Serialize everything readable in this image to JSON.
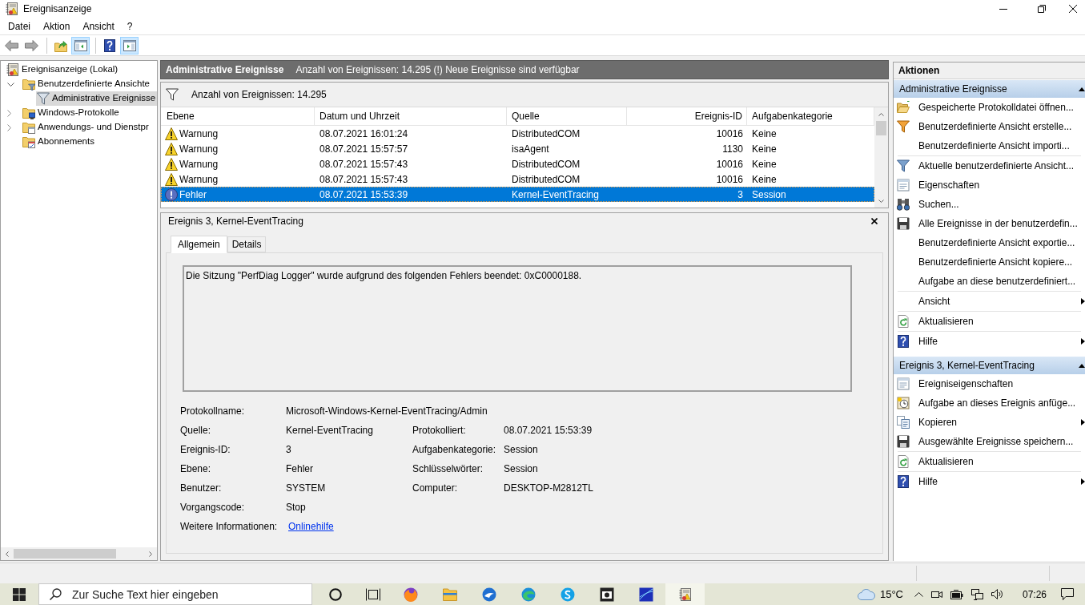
{
  "window": {
    "title": "Ereignisanzeige"
  },
  "menu": [
    "Datei",
    "Aktion",
    "Ansicht",
    "?"
  ],
  "toolbar": [
    [
      {
        "disabled": true,
        "pressed": false
      },
      {
        "disabled": true,
        "pressed": false
      }
    ],
    [
      {
        "disabled": false,
        "pressed": false
      },
      {
        "disabled": false,
        "pressed": true
      }
    ],
    [
      {
        "disabled": false,
        "pressed": false
      },
      {
        "disabled": false,
        "pressed": true
      }
    ]
  ],
  "tree": {
    "label": "Ereignisanzeige (Lokal)",
    "selected": false,
    "children": [
      {
        "label": "Benutzerdefinierte Ansichte",
        "expanded": true,
        "selected": false,
        "children": [
          {
            "label": "Administrative Ereignisse",
            "selected": true
          }
        ]
      },
      {
        "label": "Windows-Protokolle",
        "expanded": false,
        "selected": false
      },
      {
        "label": "Anwendungs- und Dienstpr",
        "expanded": false,
        "selected": false
      },
      {
        "label": "Abonnements",
        "selected": false
      }
    ]
  },
  "events_view": {
    "title": "Administrative Ereignisse",
    "notice": "Anzahl von Ereignissen: 14.295 (!) Neue Ereignisse sind verfügbar",
    "filter_summary": "Anzahl von Ereignissen: 14.295"
  },
  "table": {
    "columns": [
      "Ebene",
      "Datum und Uhrzeit",
      "Quelle",
      "Ereignis-ID",
      "Aufgabenkategorie"
    ],
    "rows": [
      {
        "kind": "warning",
        "selected": false,
        "cells": [
          "Warnung",
          "08.07.2021 16:01:24",
          "DistributedCOM",
          "10016",
          "Keine"
        ]
      },
      {
        "kind": "warning",
        "selected": false,
        "cells": [
          "Warnung",
          "08.07.2021 15:57:57",
          "isaAgent",
          "1130",
          "Keine"
        ]
      },
      {
        "kind": "warning",
        "selected": false,
        "cells": [
          "Warnung",
          "08.07.2021 15:57:43",
          "DistributedCOM",
          "10016",
          "Keine"
        ]
      },
      {
        "kind": "warning",
        "selected": false,
        "cells": [
          "Warnung",
          "08.07.2021 15:57:43",
          "DistributedCOM",
          "10016",
          "Keine"
        ]
      },
      {
        "kind": "error",
        "selected": true,
        "cells": [
          "Fehler",
          "08.07.2021 15:53:39",
          "Kernel-EventTracing",
          "3",
          "Session"
        ]
      }
    ]
  },
  "details": {
    "title": "Ereignis 3, Kernel-EventTracing",
    "tabs": [
      {
        "label": "Allgemein",
        "selected": true
      },
      {
        "label": "Details",
        "selected": false
      }
    ],
    "description": "Die Sitzung \"PerfDiag Logger\" wurde aufgrund des folgenden Fehlers beendet: 0xC0000188.",
    "property_rows": [
      [
        {
          "label": "Protokollname:",
          "value": "Microsoft-Windows-Kernel-EventTracing/Admin"
        }
      ],
      [
        {
          "label": "Quelle:",
          "value": "Kernel-EventTracing"
        },
        {
          "label": "Protokolliert:",
          "value": "08.07.2021 15:53:39"
        }
      ],
      [
        {
          "label": "Ereignis-ID:",
          "value": "3"
        },
        {
          "label": "Aufgabenkategorie:",
          "value": "Session"
        }
      ],
      [
        {
          "label": "Ebene:",
          "value": "Fehler"
        },
        {
          "label": "Schlüsselwörter:",
          "value": "Session"
        }
      ],
      [
        {
          "label": "Benutzer:",
          "value": "SYSTEM"
        },
        {
          "label": "Computer:",
          "value": "DESKTOP-M2812TL"
        }
      ],
      [
        {
          "label": "Vorgangscode:",
          "value": "Stop"
        }
      ]
    ],
    "more_info": {
      "label": "Weitere Informationen:",
      "link": "Onlinehilfe"
    }
  },
  "actions": {
    "title": "Aktionen",
    "sections": [
      {
        "title": "Administrative Ereignisse",
        "expanded": true,
        "groups": [
          [
            {
              "label": "Gespeicherte Protokolldatei öffnen...",
              "submenu": false
            },
            {
              "label": "Benutzerdefinierte Ansicht erstelle...",
              "submenu": false
            },
            {
              "label": "Benutzerdefinierte Ansicht importi...",
              "submenu": false
            }
          ],
          [
            {
              "label": "Aktuelle benutzerdefinierte Ansicht...",
              "submenu": false
            },
            {
              "label": "Eigenschaften",
              "submenu": false
            },
            {
              "label": "Suchen...",
              "submenu": false
            },
            {
              "label": "Alle Ereignisse in der benutzerdefin...",
              "submenu": false
            },
            {
              "label": "Benutzerdefinierte Ansicht exportie...",
              "submenu": false
            },
            {
              "label": "Benutzerdefinierte Ansicht kopiere...",
              "submenu": false
            },
            {
              "label": "Aufgabe an diese benutzerdefiniert...",
              "submenu": false
            }
          ],
          [
            {
              "label": "Ansicht",
              "submenu": true
            }
          ],
          [
            {
              "label": "Aktualisieren",
              "submenu": false
            }
          ],
          [
            {
              "label": "Hilfe",
              "submenu": true
            }
          ]
        ]
      },
      {
        "title": "Ereignis 3, Kernel-EventTracing",
        "expanded": true,
        "groups": [
          [
            {
              "label": "Ereigniseigenschaften",
              "submenu": false
            },
            {
              "label": "Aufgabe an dieses Ereignis anfüge...",
              "submenu": false
            },
            {
              "label": "Kopieren",
              "submenu": true
            },
            {
              "label": "Ausgewählte Ereignisse speichern...",
              "submenu": false
            }
          ],
          [
            {
              "label": "Aktualisieren",
              "submenu": false
            }
          ],
          [
            {
              "label": "Hilfe",
              "submenu": true
            }
          ]
        ]
      }
    ]
  },
  "taskbar": {
    "search_placeholder": "Zur Suche Text hier eingeben",
    "apps": [
      {
        "active": false
      },
      {
        "active": false
      },
      {
        "active": false
      },
      {
        "active": false
      },
      {
        "active": false
      },
      {
        "active": false
      },
      {
        "active": false
      },
      {
        "active": true
      }
    ],
    "weather": "15°C",
    "time": "07:26"
  }
}
